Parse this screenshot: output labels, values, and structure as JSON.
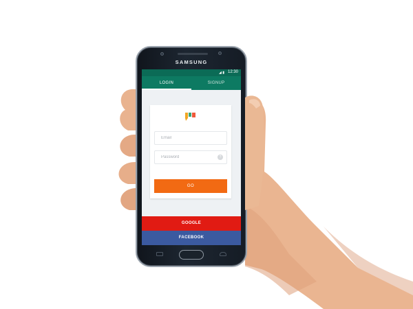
{
  "device": {
    "brand": "SAMSUNG"
  },
  "status_bar": {
    "time": "12:30",
    "icons": "◢ ▮"
  },
  "tabs": [
    {
      "label": "LOGIN",
      "active": true
    },
    {
      "label": "SIGNUP",
      "active": false
    }
  ],
  "login_form": {
    "email_placeholder": "Email",
    "password_placeholder": "Password",
    "help_icon": "?",
    "go_label": "GO"
  },
  "social_buttons": {
    "google_label": "GOOGLE",
    "facebook_label": "FACEBOOK"
  },
  "colors": {
    "status_bar": "#0b6b56",
    "tab_bar": "#0d7a62",
    "go_button": "#f26a13",
    "google": "#e11b13",
    "facebook": "#3b5aa0",
    "screen_bg": "#eef1f4"
  },
  "icons": [
    "signal-icon",
    "battery-icon",
    "app-logo-icon",
    "help-icon",
    "home-button-icon"
  ]
}
